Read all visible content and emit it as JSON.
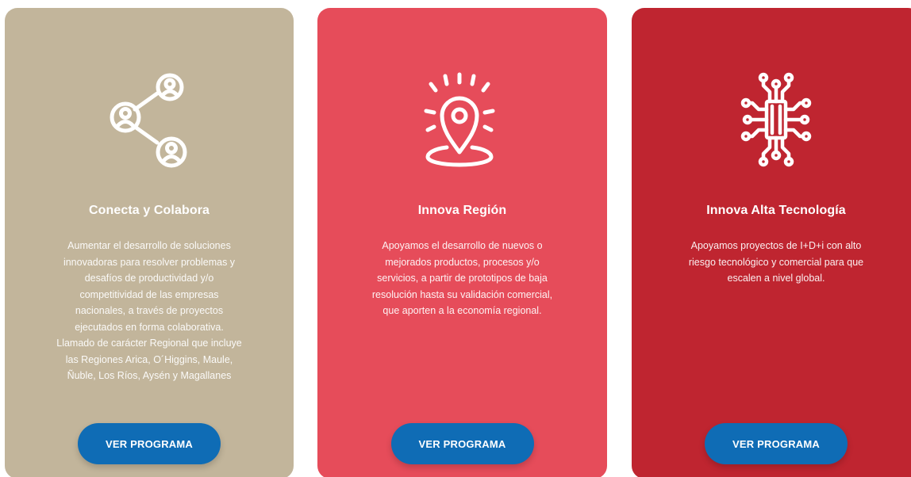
{
  "colors": {
    "card_tan": "#c2b59b",
    "card_red": "#e64c5a",
    "card_dark_red": "#bf2530",
    "button_blue": "#0f6cb5"
  },
  "cards": [
    {
      "title": "Conecta y Colabora",
      "icon": "share-network-users-icon",
      "description": "Aumentar el desarrollo de soluciones\ninnovadoras para resolver problemas y\ndesafíos de productividad y/o\ncompetitividad de las empresas\nnacionales, a través de proyectos\nejecutados en forma colaborativa.\nLlamado de carácter Regional que incluye\nlas Regiones Arica, O´Higgins, Maule,\nÑuble, Los Ríos, Aysén y Magallanes",
      "button_label": "VER PROGRAMA"
    },
    {
      "title": "Innova Región",
      "icon": "map-pin-radiating-icon",
      "description": "Apoyamos el desarrollo de nuevos o\nmejorados productos, procesos y/o\nservicios, a partir de prototipos de baja\nresolución hasta su validación comercial,\nque aporten a la economía regional.",
      "button_label": "VER PROGRAMA"
    },
    {
      "title": "Innova Alta Tecnología",
      "icon": "circuit-chip-icon",
      "description": "Apoyamos proyectos de I+D+i con alto\nriesgo tecnológico y comercial para que\nescalen a nivel global.",
      "button_label": "VER PROGRAMA"
    }
  ]
}
